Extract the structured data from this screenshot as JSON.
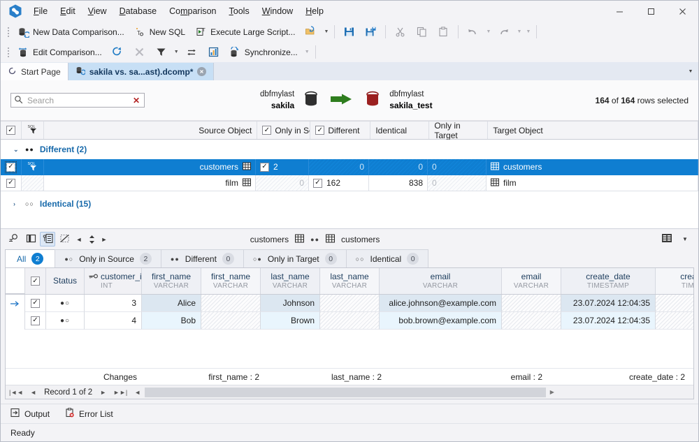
{
  "window": {
    "minimize": "—",
    "maximize": "□",
    "close": "✕"
  },
  "menu": {
    "items": [
      {
        "label": "File",
        "accel": "F"
      },
      {
        "label": "Edit",
        "accel": "E"
      },
      {
        "label": "View",
        "accel": "V"
      },
      {
        "label": "Database",
        "accel": "D"
      },
      {
        "label": "Comparison",
        "accel": "m"
      },
      {
        "label": "Tools",
        "accel": "T"
      },
      {
        "label": "Window",
        "accel": "W"
      },
      {
        "label": "Help",
        "accel": "H"
      }
    ]
  },
  "toolbar1": {
    "new_data_comparison": "New Data Comparison...",
    "new_sql": "New SQL",
    "execute_large_script": "Execute Large Script...",
    "open_icon": "open-folder-icon",
    "save_icon": "save-icon",
    "save_all_icon": "save-all-icon",
    "cut_icon": "cut-icon",
    "copy_icon": "copy-icon",
    "paste_icon": "paste-icon",
    "undo_icon": "undo-icon",
    "redo_icon": "redo-icon"
  },
  "toolbar2": {
    "edit_comparison": "Edit Comparison...",
    "refresh_icon": "refresh-icon",
    "stop_icon": "stop-icon",
    "filter_icon": "filter-icon",
    "swap_icon": "swap-icon",
    "report_icon": "report-icon",
    "synchronize": "Synchronize..."
  },
  "tabs": {
    "items": [
      {
        "label": "Start Page",
        "active": false,
        "icon": "start-page-icon"
      },
      {
        "label": "sakila vs. sa...ast).dcomp*",
        "active": true,
        "icon": "comparison-doc-icon"
      }
    ],
    "close_glyph": "⊗"
  },
  "compare_header": {
    "search_placeholder": "Search",
    "search_value": "",
    "search_icon": "search-icon",
    "clear_glyph": "✕",
    "source": {
      "server": "dbfmylast",
      "database": "sakila"
    },
    "target": {
      "server": "dbfmylast",
      "database": "sakila_test"
    },
    "arrow_icon": "sync-direction-arrow-icon",
    "rows_selected": {
      "selected": "164",
      "of": "of",
      "total": "164",
      "suffix": "rows selected"
    }
  },
  "comparison_grid": {
    "headers": {
      "checkbox": "select-all",
      "sql_filter": "sql-filter-icon",
      "source_object": "Source Object",
      "only_in_source": "Only in Sourc",
      "different": "Different",
      "identical": "Identical",
      "only_in_target": "Only in Target",
      "target_object": "Target Object"
    },
    "groups": [
      {
        "label": "Different (2)",
        "expanded": true,
        "chevron": "⌄",
        "dots": "●●",
        "rows": [
          {
            "selected": true,
            "checked": true,
            "source_object": "customers",
            "only_in_source": "2",
            "different": "0",
            "identical": "0",
            "only_in_target": "0",
            "target_object": "customers",
            "ois_checked": true,
            "diff_checked": false,
            "hatched": [
              "different",
              "identical",
              "only_in_target"
            ]
          },
          {
            "selected": false,
            "checked": true,
            "source_object": "film",
            "only_in_source": "0",
            "different": "162",
            "identical": "838",
            "only_in_target": "0",
            "target_object": "film",
            "ois_checked": false,
            "diff_checked": true,
            "hatched": [
              "only_in_source",
              "only_in_target"
            ]
          }
        ]
      },
      {
        "label": "Identical (15)",
        "expanded": false,
        "chevron": "›",
        "dots": "○○",
        "rows": []
      }
    ]
  },
  "detail_toolbar": {
    "find_icon": "find-icon",
    "split_view_icon": "split-view-icon",
    "record_view_icon": "record-view-icon",
    "hide_equal_icon": "hide-equal-columns-icon",
    "prev_icon": "◄",
    "updown_icon": "up-down-spinner-icon",
    "next_icon": "►",
    "source_object": "customers",
    "target_object": "customers",
    "middle_dots": "●●",
    "columns_icon": "column-chooser-icon",
    "dropdown_icon": "▾"
  },
  "detail_tabs": [
    {
      "label": "All",
      "count": "2",
      "dots": "",
      "active": true,
      "blue": true
    },
    {
      "label": "Only in Source",
      "count": "2",
      "dots": "●○",
      "active": false,
      "blue": false
    },
    {
      "label": "Different",
      "count": "0",
      "dots": "●●",
      "active": false,
      "blue": false
    },
    {
      "label": "Only in Target",
      "count": "0",
      "dots": "○●",
      "active": false,
      "blue": false
    },
    {
      "label": "Identical",
      "count": "0",
      "dots": "○○",
      "active": false,
      "blue": false
    }
  ],
  "data_grid": {
    "columns": [
      {
        "name": "Status",
        "type": "",
        "side": "status"
      },
      {
        "name": "customer_id",
        "type": "INT",
        "side": "key"
      },
      {
        "name": "first_name",
        "type": "VARCHAR",
        "side": "source"
      },
      {
        "name": "first_name",
        "type": "VARCHAR",
        "side": "target"
      },
      {
        "name": "last_name",
        "type": "VARCHAR",
        "side": "source"
      },
      {
        "name": "last_name",
        "type": "VARCHAR",
        "side": "target"
      },
      {
        "name": "email",
        "type": "VARCHAR",
        "side": "source"
      },
      {
        "name": "email",
        "type": "VARCHAR",
        "side": "target"
      },
      {
        "name": "create_date",
        "type": "TIMESTAMP",
        "side": "source"
      },
      {
        "name": "create_date",
        "type": "TIMESTAMP",
        "side": "target"
      }
    ],
    "rows": [
      {
        "current": true,
        "checked": true,
        "status": "●○",
        "customer_id": "3",
        "first_name_src": "Alice",
        "first_name_tgt": "",
        "last_name_src": "Johnson",
        "last_name_tgt": "",
        "email_src": "alice.johnson@example.com",
        "email_tgt": "",
        "create_date_src": "23.07.2024 12:04:35",
        "create_date_tgt": ""
      },
      {
        "current": false,
        "checked": true,
        "status": "●○",
        "customer_id": "4",
        "first_name_src": "Bob",
        "first_name_tgt": "",
        "last_name_src": "Brown",
        "last_name_tgt": "",
        "email_src": "bob.brown@example.com",
        "email_tgt": "",
        "create_date_src": "23.07.2024 12:04:35",
        "create_date_tgt": ""
      }
    ],
    "summary": {
      "changes_label": "Changes",
      "first_name": "first_name : 2",
      "last_name": "last_name : 2",
      "email": "email : 2",
      "create_date": "create_date : 2"
    },
    "navigator": {
      "first": "|◄◄",
      "prev": "◄",
      "record_label": "Record 1 of 2",
      "next": "►",
      "last": "►►|",
      "extra": "◄"
    }
  },
  "panel_bar": {
    "output": "Output",
    "output_icon": "output-icon",
    "error_list": "Error List",
    "error_icon": "error-list-icon"
  },
  "status_bar": {
    "text": "Ready"
  },
  "colors": {
    "accent": "#0f7ed1",
    "link": "#1769aa",
    "source_db": "#333333",
    "target_db": "#9b2020",
    "arrow": "#2e7d1e"
  }
}
